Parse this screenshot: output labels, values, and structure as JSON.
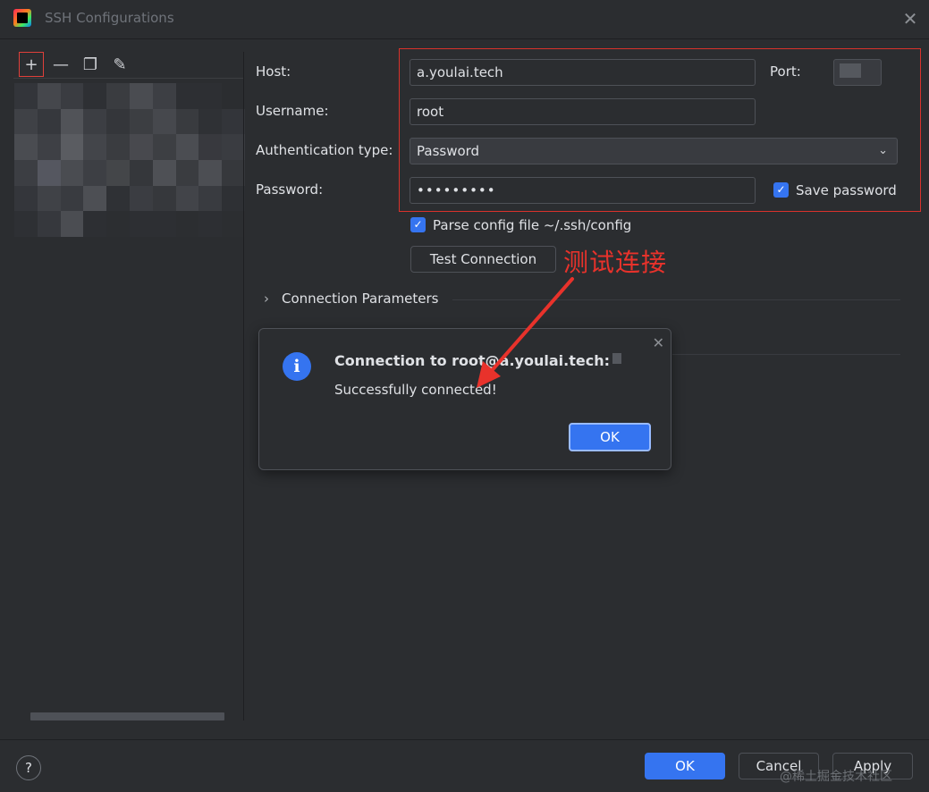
{
  "window": {
    "title": "SSH Configurations",
    "close_glyph": "✕"
  },
  "toolbar": {
    "add_glyph": "+",
    "remove_glyph": "—",
    "copy_glyph": "❐",
    "edit_glyph": "✎"
  },
  "form": {
    "host_label": "Host:",
    "host_value": "a.youlai.tech",
    "port_label": "Port:",
    "username_label": "Username:",
    "username_value": "root",
    "auth_label": "Authentication type:",
    "auth_value": "Password",
    "password_label": "Password:",
    "password_value": "•••••••••",
    "save_password_label": "Save password",
    "save_password_checked": true,
    "parse_config_label": "Parse config file ~/.ssh/config",
    "parse_config_checked": true,
    "test_connection_label": "Test Connection",
    "connection_params_label": "Connection Parameters",
    "expand_glyph": "›",
    "chevron_glyph": "⌄"
  },
  "annotation": {
    "text": "测试连接",
    "color": "#e8322b"
  },
  "popup": {
    "title": "Connection to root@a.youlai.tech:",
    "message": "Successfully connected!",
    "ok_label": "OK",
    "info_glyph": "i",
    "close_glyph": "✕"
  },
  "footer": {
    "help_glyph": "?",
    "ok_label": "OK",
    "cancel_label": "Cancel",
    "apply_label": "Apply"
  },
  "watermark": "@稀土掘金技术社区",
  "colors": {
    "accent": "#3574f0",
    "highlight_border": "#d9322b",
    "background": "#2b2d30"
  }
}
